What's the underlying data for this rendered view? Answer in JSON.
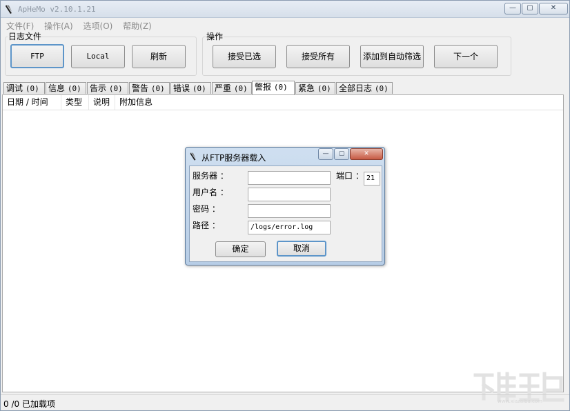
{
  "window": {
    "title": "ApHeMo v2.10.1.21",
    "min": "—",
    "max": "▢",
    "close": "✕"
  },
  "menu": [
    "文件(F)",
    "操作(A)",
    "选项(O)",
    "帮助(Z)"
  ],
  "log_file_group": {
    "label": "日志文件",
    "buttons": [
      "FTP",
      "Local",
      "刷新"
    ]
  },
  "actions_group": {
    "label": "操作",
    "buttons": [
      "接受已选",
      "接受所有",
      "添加到自动筛选",
      "下一个"
    ]
  },
  "tabs": [
    {
      "label": "调试",
      "count": "(0)"
    },
    {
      "label": "信息",
      "count": "(0)"
    },
    {
      "label": "告示",
      "count": "(0)"
    },
    {
      "label": "警告",
      "count": "(0)"
    },
    {
      "label": "错误",
      "count": "(0)"
    },
    {
      "label": "严重",
      "count": "(0)"
    },
    {
      "label": "警报",
      "count": "(0)"
    },
    {
      "label": "紧急",
      "count": "(0)"
    },
    {
      "label": "全部日志",
      "count": "(0)"
    }
  ],
  "active_tab": "警报",
  "columns": [
    "日期 / 时间",
    "类型",
    "说明",
    "附加信息"
  ],
  "status": "0 /0 已加载项",
  "dialog": {
    "title": "从FTP服务器载入",
    "server_label": "服务器 ：",
    "port_label": "端口 ：",
    "port_value": "21",
    "user_label": "用户名 ：",
    "password_label": "密码 ：",
    "path_label": "路径 ：",
    "server_value": "",
    "user_value": "",
    "password_value": "",
    "path_value": "/logs/error.log",
    "ok_label": "确定",
    "cancel_label": "取消"
  },
  "colors": {
    "title_text": "#8e98a4",
    "menu_text": "#8a8a8a",
    "focus_border": "#5d95c9",
    "dialog_frame": "#b7cde6"
  }
}
